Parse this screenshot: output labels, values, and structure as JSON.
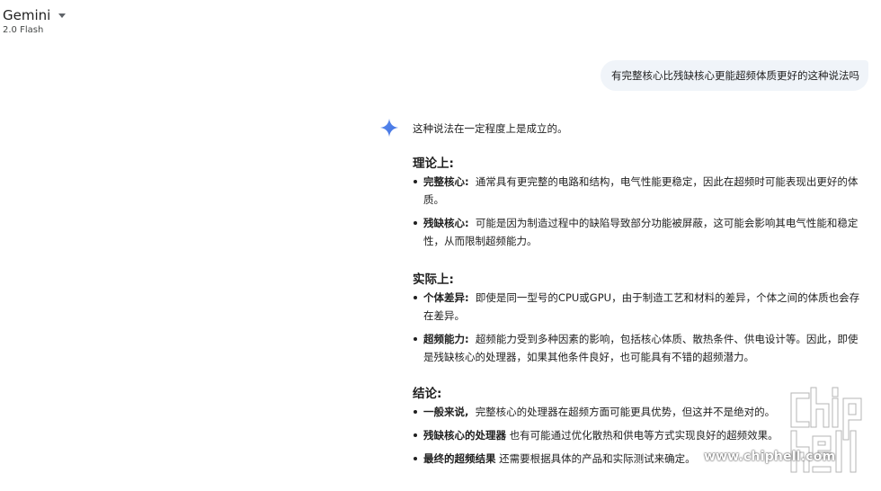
{
  "header": {
    "model_name": "Gemini",
    "model_version": "2.0 Flash",
    "dropdown_icon": "caret-down-icon"
  },
  "conversation": {
    "user_message": "有完整核心比残缺核心更能超频体质更好的这种说法吗",
    "response": {
      "icon": "gemini-sparkle-icon",
      "intro": "这种说法在一定程度上是成立的。",
      "sections": [
        {
          "heading": "理论上:",
          "items": [
            {
              "term": "完整核心:",
              "text": "通常具有更完整的电路和结构，电气性能更稳定，因此在超频时可能表现出更好的体质。"
            },
            {
              "term": "残缺核心:",
              "text": "可能是因为制造过程中的缺陷导致部分功能被屏蔽，这可能会影响其电气性能和稳定性，从而限制超频能力。"
            }
          ]
        },
        {
          "heading": "实际上:",
          "items": [
            {
              "term": "个体差异:",
              "text": "即使是同一型号的CPU或GPU，由于制造工艺和材料的差异，个体之间的体质也会存在差异。"
            },
            {
              "term": "超频能力:",
              "text": "超频能力受到多种因素的影响，包括核心体质、散热条件、供电设计等。因此，即使是残缺核心的处理器，如果其他条件良好，也可能具有不错的超频潜力。"
            }
          ]
        },
        {
          "heading": "结论:",
          "items": [
            {
              "term": "一般来说,",
              "text": "完整核心的处理器在超频方面可能更具优势，但这并不是绝对的。"
            },
            {
              "term": "残缺核心的处理器",
              "text": "也有可能通过优化散热和供电等方式实现良好的超频效果。"
            },
            {
              "term": "最终的超频结果",
              "text": "还需要根据具体的产品和实际测试来确定。"
            }
          ]
        }
      ]
    }
  },
  "watermark": {
    "logo": "chiphell-logo",
    "url": "www.chiphell.com"
  },
  "colors": {
    "user_bubble": "#f0f4f9",
    "sparkle": "#4a7cf0",
    "text": "#1f1f1f"
  }
}
